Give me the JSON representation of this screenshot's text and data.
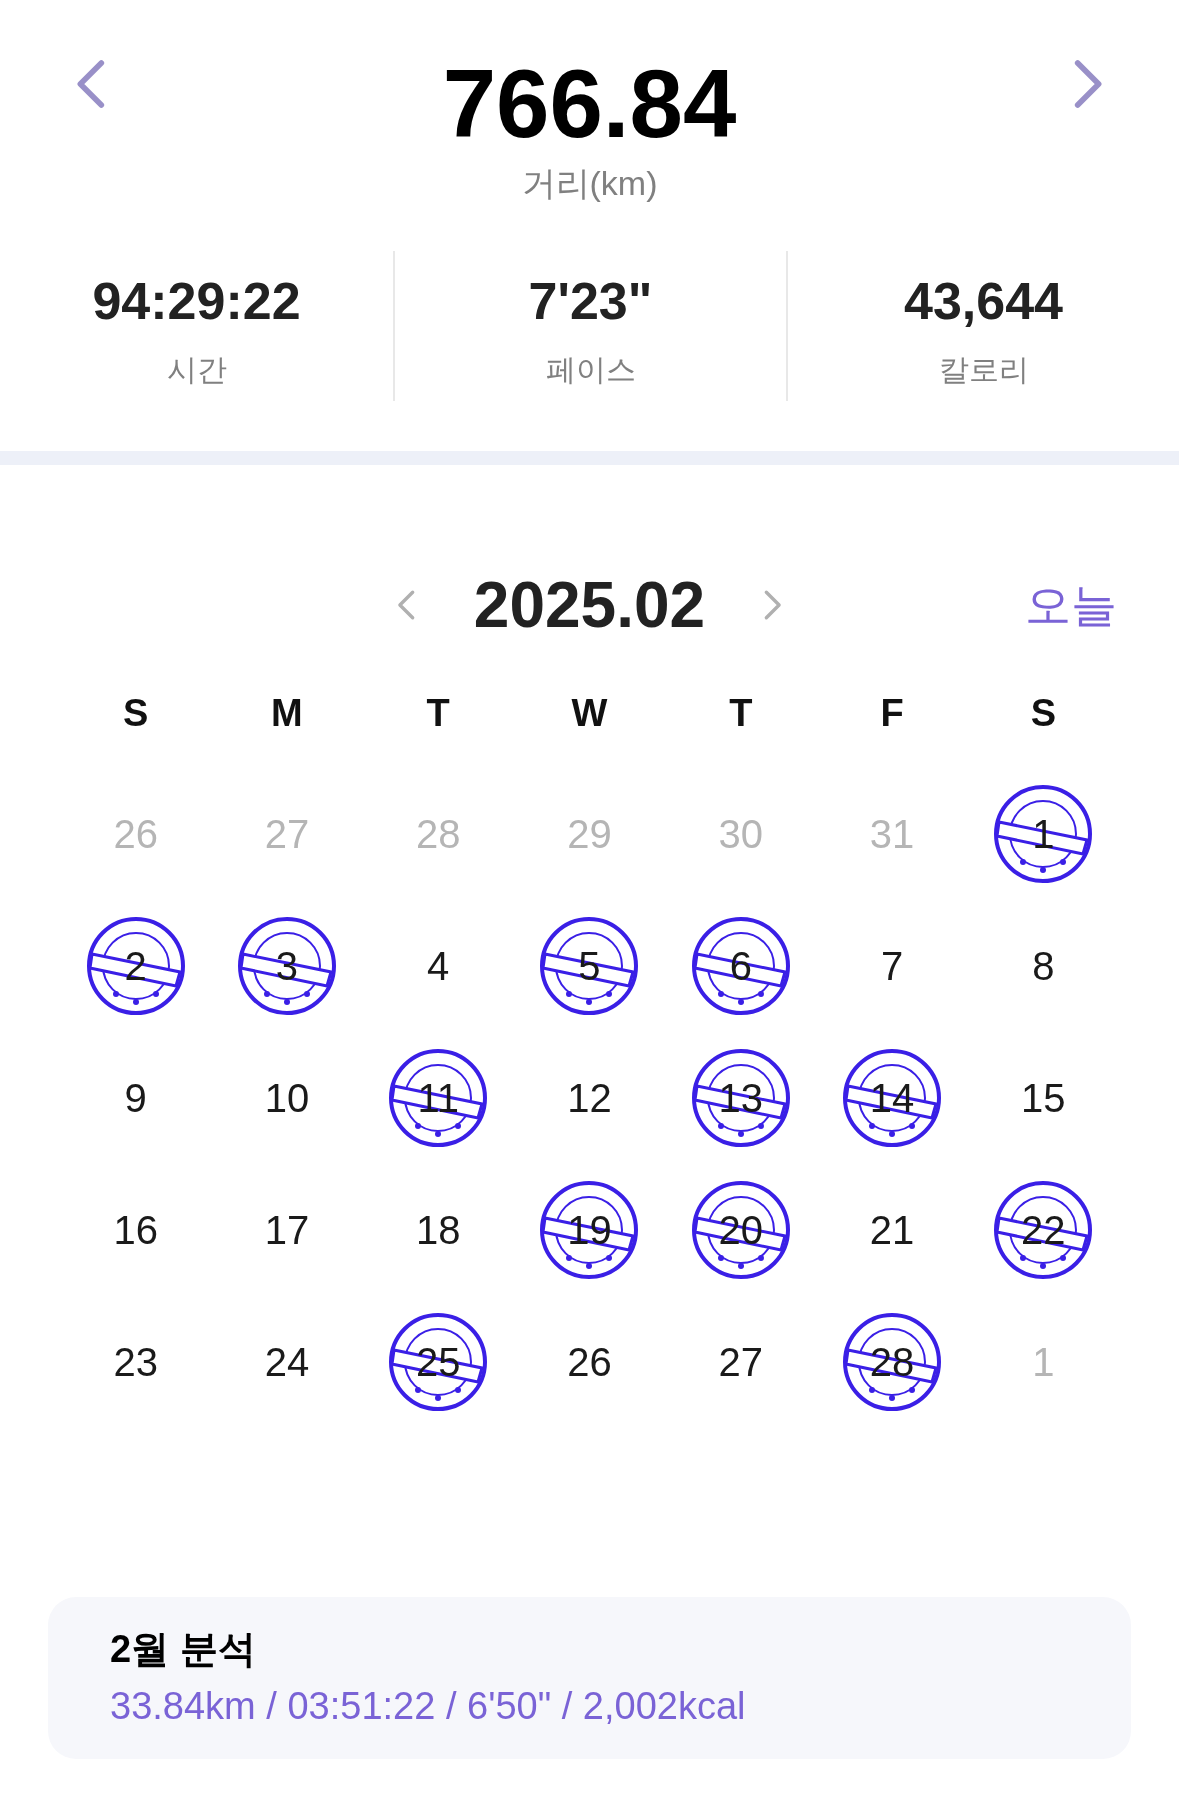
{
  "summary": {
    "distance": "766.84",
    "distance_label": "거리(km)",
    "stats": [
      {
        "value": "94:29:22",
        "label": "시간"
      },
      {
        "value": "7'23\"",
        "label": "페이스"
      },
      {
        "value": "43,644",
        "label": "칼로리"
      }
    ]
  },
  "calendar": {
    "title": "2025.02",
    "today_button": "오늘",
    "weekdays": [
      "S",
      "M",
      "T",
      "W",
      "T",
      "F",
      "S"
    ],
    "weeks": [
      [
        {
          "day": "26",
          "muted": true,
          "stamped": false
        },
        {
          "day": "27",
          "muted": true,
          "stamped": false
        },
        {
          "day": "28",
          "muted": true,
          "stamped": false
        },
        {
          "day": "29",
          "muted": true,
          "stamped": false
        },
        {
          "day": "30",
          "muted": true,
          "stamped": false
        },
        {
          "day": "31",
          "muted": true,
          "stamped": false
        },
        {
          "day": "1",
          "muted": false,
          "stamped": true
        }
      ],
      [
        {
          "day": "2",
          "muted": false,
          "stamped": true
        },
        {
          "day": "3",
          "muted": false,
          "stamped": true
        },
        {
          "day": "4",
          "muted": false,
          "stamped": false
        },
        {
          "day": "5",
          "muted": false,
          "stamped": true
        },
        {
          "day": "6",
          "muted": false,
          "stamped": true
        },
        {
          "day": "7",
          "muted": false,
          "stamped": false
        },
        {
          "day": "8",
          "muted": false,
          "stamped": false
        }
      ],
      [
        {
          "day": "9",
          "muted": false,
          "stamped": false
        },
        {
          "day": "10",
          "muted": false,
          "stamped": false
        },
        {
          "day": "11",
          "muted": false,
          "stamped": true
        },
        {
          "day": "12",
          "muted": false,
          "stamped": false
        },
        {
          "day": "13",
          "muted": false,
          "stamped": true
        },
        {
          "day": "14",
          "muted": false,
          "stamped": true
        },
        {
          "day": "15",
          "muted": false,
          "stamped": false
        }
      ],
      [
        {
          "day": "16",
          "muted": false,
          "stamped": false
        },
        {
          "day": "17",
          "muted": false,
          "stamped": false
        },
        {
          "day": "18",
          "muted": false,
          "stamped": false
        },
        {
          "day": "19",
          "muted": false,
          "stamped": true
        },
        {
          "day": "20",
          "muted": false,
          "stamped": true
        },
        {
          "day": "21",
          "muted": false,
          "stamped": false
        },
        {
          "day": "22",
          "muted": false,
          "stamped": true
        }
      ],
      [
        {
          "day": "23",
          "muted": false,
          "stamped": false
        },
        {
          "day": "24",
          "muted": false,
          "stamped": false
        },
        {
          "day": "25",
          "muted": false,
          "stamped": true
        },
        {
          "day": "26",
          "muted": false,
          "stamped": false
        },
        {
          "day": "27",
          "muted": false,
          "stamped": false
        },
        {
          "day": "28",
          "muted": false,
          "stamped": true
        },
        {
          "day": "1",
          "muted": true,
          "stamped": false
        }
      ]
    ]
  },
  "analysis": {
    "title": "2월 분석",
    "detail": "33.84km / 03:51:22 / 6'50\" / 2,002kcal"
  }
}
